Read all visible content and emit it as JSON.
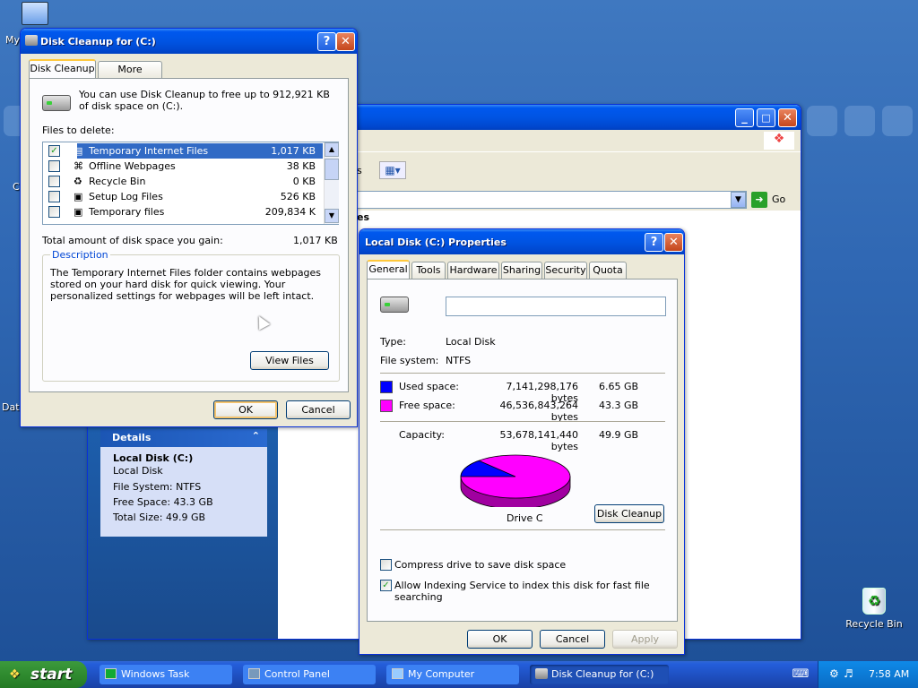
{
  "desktop": {
    "icons": [
      {
        "label": "My",
        "name": "my-computer"
      },
      {
        "label": "C",
        "name": "control-panel"
      },
      {
        "label": "Dat",
        "name": "data"
      },
      {
        "label": "Recycle Bin",
        "name": "recycle-bin"
      }
    ]
  },
  "explorer": {
    "go_label": "Go",
    "header_fragment": "es",
    "details": {
      "title": "Details",
      "name": "Local Disk (C:)",
      "type": "Local Disk",
      "file_system": "File System: NTFS",
      "free_space": "Free Space: 43.3 GB",
      "total_size": "Total Size: 49.9 GB"
    }
  },
  "cleanup": {
    "title": "Disk Cleanup for  (C:)",
    "tabs": [
      "Disk Cleanup",
      "More Options"
    ],
    "intro": "You can use Disk Cleanup to free up to 912,921 KB of disk space on  (C:).",
    "files_label": "Files to delete:",
    "files": [
      {
        "name": "Temporary Internet Files",
        "size": "1,017 KB",
        "checked": true,
        "icon": "▤"
      },
      {
        "name": "Offline Webpages",
        "size": "38 KB",
        "checked": false,
        "icon": "⌘"
      },
      {
        "name": "Recycle Bin",
        "size": "0 KB",
        "checked": false,
        "icon": "♻"
      },
      {
        "name": "Setup Log Files",
        "size": "526 KB",
        "checked": false,
        "icon": "▣"
      },
      {
        "name": "Temporary files",
        "size": "209,834 K",
        "checked": false,
        "icon": "▣"
      }
    ],
    "total_label": "Total amount of disk space you gain:",
    "total_value": "1,017 KB",
    "description_label": "Description",
    "description": "The Temporary Internet Files folder contains webpages stored on your hard disk for quick viewing. Your personalized settings for webpages will be left intact.",
    "view_files": "View Files",
    "ok": "OK",
    "cancel": "Cancel"
  },
  "props": {
    "title": "Local Disk (C:) Properties",
    "tabs": [
      "General",
      "Tools",
      "Hardware",
      "Sharing",
      "Security",
      "Quota"
    ],
    "label_value": "",
    "type_label": "Type:",
    "type_value": "Local Disk",
    "fs_label": "File system:",
    "fs_value": "NTFS",
    "used_label": "Used space:",
    "used_bytes": "7,141,298,176 bytes",
    "used_gb": "6.65 GB",
    "free_label": "Free space:",
    "free_bytes": "46,536,843,264 bytes",
    "free_gb": "43.3 GB",
    "cap_label": "Capacity:",
    "cap_bytes": "53,678,141,440 bytes",
    "cap_gb": "49.9 GB",
    "drive_label": "Drive C",
    "disk_cleanup": "Disk Cleanup",
    "compress_label": "Compress drive to save disk space",
    "compress_checked": false,
    "index_label": "Allow Indexing Service to index this disk for fast file searching",
    "index_checked": true,
    "ok": "OK",
    "cancel": "Cancel",
    "apply": "Apply",
    "used_fraction": 0.133,
    "colors": {
      "used": "#0000ff",
      "free": "#ff00ff"
    }
  },
  "taskbar": {
    "start": "start",
    "items": [
      "Windows Task Manager",
      "Control Panel",
      "My Computer",
      "Disk Cleanup for  (C:)"
    ],
    "time": "7:58 AM"
  }
}
